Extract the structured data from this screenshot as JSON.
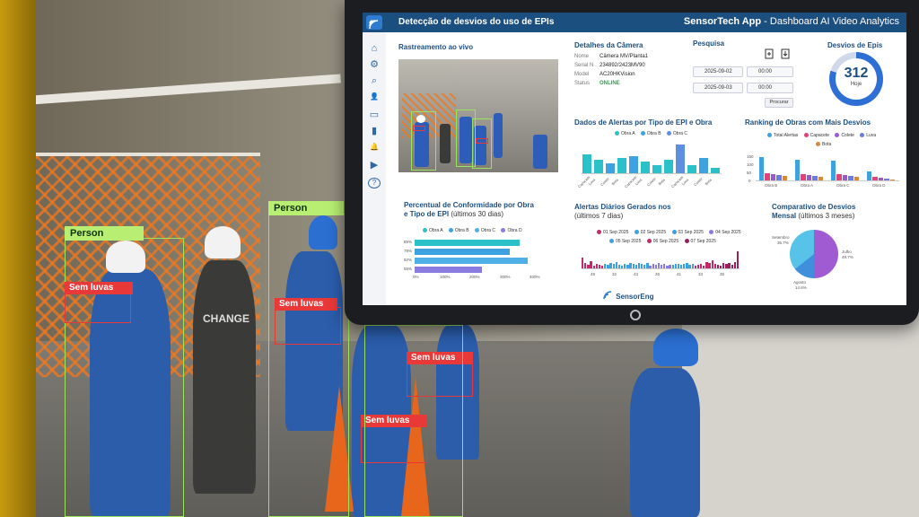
{
  "scene": {
    "labels": {
      "person_1": "Person",
      "person_2": "Person",
      "no_gloves_1": "Sem luvas",
      "no_gloves_2": "Sem luvas",
      "no_gloves_3": "Sem luvas",
      "no_gloves_4": "Sem luvas",
      "shirt_text": "CHANGE"
    }
  },
  "app": {
    "header_title": "Detecção de desvios do uso de EPIs",
    "app_name": "SensorTech App",
    "app_subtitle": " - Dashboard AI  Video Analytics",
    "footer_brand": "SensorEng"
  },
  "sidebar": {
    "items": [
      {
        "icon": "home-icon",
        "glyph": "⌂"
      },
      {
        "icon": "gear-icon",
        "glyph": "⚙"
      },
      {
        "icon": "search-icon",
        "glyph": "⌕"
      },
      {
        "icon": "user-icon",
        "glyph": "👤"
      },
      {
        "icon": "camera-icon",
        "glyph": "▭"
      },
      {
        "icon": "chart-icon",
        "glyph": "▮"
      },
      {
        "icon": "bell-icon",
        "glyph": "🔔"
      },
      {
        "icon": "video-icon",
        "glyph": "▶"
      },
      {
        "icon": "help-icon",
        "glyph": "?"
      }
    ]
  },
  "live": {
    "title": "Rastreamento ao vivo"
  },
  "camera": {
    "title": "Detalhes da Câmera",
    "rows": [
      {
        "label": "Nome",
        "value": "Câmera MV/Planta1"
      },
      {
        "label": "Serial N",
        "value": "234892/2423MV90"
      },
      {
        "label": "Model",
        "value": "AC20HKVision"
      },
      {
        "label": "Status",
        "value": "ONLINE"
      }
    ],
    "status_color": "#2aa84a"
  },
  "search": {
    "title": "Pesquisa",
    "date_from": "2025-09-02",
    "date_to": "2025-09-03",
    "time_from": "00:00",
    "time_to": "00:00",
    "search_button": "Procurar"
  },
  "desvios": {
    "title": "Desvios de Epis",
    "value": "312",
    "caption": "Hoje"
  },
  "alerts_by_type": {
    "title": "Dados de Alertas por Tipo de EPI e Obra",
    "legend": [
      "Obra A",
      "Obra B",
      "Obra C"
    ],
    "categories": [
      "Capacete",
      "Luva",
      "Colete",
      "Bota",
      "Capacete",
      "Luva",
      "Colete",
      "Bota",
      "Capacete",
      "Luva",
      "Colete",
      "Bota"
    ]
  },
  "ranking": {
    "title": "Ranking de Obras com Mais Desvios",
    "legend": [
      "Total Alertas",
      "Capacete",
      "Colete",
      "Luva",
      "Bota"
    ],
    "categories": [
      "Obra B",
      "Obra A",
      "Obra C",
      "Obra D"
    ],
    "yticks": [
      "150",
      "100",
      "50",
      "0"
    ]
  },
  "compliance": {
    "title": "Percentual de Conformidade por Obra e Tipo de EPI",
    "subtitle": " (últimos 30 dias)",
    "legend": [
      "Obra A",
      "Obra B",
      "Obra C",
      "Obra D"
    ],
    "rows": [
      "85%",
      "78%",
      "92%",
      "55%"
    ],
    "xticks": [
      "0%",
      "100%",
      "200%",
      "300%",
      "400%"
    ]
  },
  "daily": {
    "title": "Alertas Diários Gerados nos",
    "subtitle": "(últimos 7 dias)",
    "legend": [
      "01 Sep 2025",
      "02 Sep 2025",
      "03 Sep 2025",
      "04 Sep 2025",
      "05 Sep 2025",
      "06 Sep 2025",
      "07 Sep 2025"
    ],
    "xticks": [
      "48",
      "32",
      "43",
      "26",
      "41",
      "33",
      "35"
    ]
  },
  "monthly": {
    "title": "Comparativo de Desvios",
    "subtitle_bold": "Mensal",
    "subtitle": " (últimos 3 meses)",
    "slices": [
      {
        "label": "Julho",
        "pct": "49.7%"
      },
      {
        "label": "Agosto",
        "pct": "14.6%"
      },
      {
        "label": "Setembro",
        "pct": "35.7%"
      }
    ]
  },
  "chart_data": [
    {
      "type": "bar",
      "title": "Dados de Alertas por Tipo de EPI e Obra",
      "categories": [
        "Capacete",
        "Luva",
        "Colete",
        "Bota",
        "Capacete",
        "Luva",
        "Colete",
        "Bota",
        "Capacete",
        "Luva",
        "Colete",
        "Bota"
      ],
      "values": [
        22,
        16,
        12,
        18,
        20,
        14,
        10,
        16,
        34,
        9,
        18,
        6
      ],
      "colors": [
        "#2bc1c8",
        "#2bc1c8",
        "#3fa2e0",
        "#2bc1c8",
        "#3fa2e0",
        "#2bc1c8",
        "#2bc1c8",
        "#2bc1c8",
        "#5d8fe0",
        "#2bc1c8",
        "#3fa2e0",
        "#2bc1c8"
      ],
      "ylim": [
        0,
        40
      ]
    },
    {
      "type": "bar",
      "title": "Ranking de Obras com Mais Desvios",
      "categories": [
        "Obra B",
        "Obra A",
        "Obra C",
        "Obra D"
      ],
      "series": [
        {
          "name": "Total Alertas",
          "values": [
            140,
            125,
            120,
            55
          ],
          "color": "#3fa2e0"
        },
        {
          "name": "Capacete",
          "values": [
            45,
            40,
            35,
            20
          ],
          "color": "#e0427a"
        },
        {
          "name": "Colete",
          "values": [
            35,
            30,
            30,
            15
          ],
          "color": "#9b59d0"
        },
        {
          "name": "Luva",
          "values": [
            30,
            28,
            25,
            10
          ],
          "color": "#6d7be0"
        },
        {
          "name": "Bota",
          "values": [
            25,
            22,
            20,
            8
          ],
          "color": "#d58a3a"
        }
      ],
      "ylim": [
        0,
        150
      ]
    },
    {
      "type": "bar",
      "title": "Percentual de Conformidade por Obra e Tipo de EPI",
      "orientation": "horizontal",
      "categories": [
        "85%",
        "78%",
        "92%",
        "55%"
      ],
      "values": [
        345,
        312,
        372,
        222
      ],
      "colors": [
        "#2bc1c8",
        "#3fa2e0",
        "#4fb0e6",
        "#8a7be0"
      ],
      "xlim": [
        0,
        400
      ]
    },
    {
      "type": "bar",
      "title": "Alertas Diários Gerados nos",
      "categories": [
        "48",
        "32",
        "43",
        "26",
        "41",
        "33",
        "35"
      ],
      "series": [
        {
          "name": "01 Sep 2025",
          "values": [
            12,
            6,
            4,
            8,
            3,
            5,
            4,
            3
          ],
          "color": "#c22a6a"
        },
        {
          "name": "02 Sep 2025",
          "values": [
            5,
            4,
            6,
            5,
            7,
            4,
            3,
            5
          ],
          "color": "#3fa2e0"
        },
        {
          "name": "03 Sep 2025",
          "values": [
            4,
            6,
            5,
            4,
            6,
            5,
            4,
            6
          ],
          "color": "#3fa2e0"
        },
        {
          "name": "04 Sep 2025",
          "values": [
            3,
            5,
            4,
            6,
            4,
            5,
            3,
            4
          ],
          "color": "#8a7be0"
        },
        {
          "name": "05 Sep 2025",
          "values": [
            4,
            5,
            5,
            4,
            5,
            6,
            4,
            5
          ],
          "color": "#3fa2e0"
        },
        {
          "name": "06 Sep 2025",
          "values": [
            3,
            4,
            5,
            3,
            7,
            6,
            9,
            5
          ],
          "color": "#c22a6a"
        },
        {
          "name": "07 Sep 2025",
          "values": [
            4,
            3,
            6,
            5,
            6,
            4,
            7,
            20
          ],
          "color": "#9a1f5c"
        }
      ],
      "ylim": [
        0,
        25
      ]
    },
    {
      "type": "pie",
      "title": "Comparativo de Desvios Mensal",
      "categories": [
        "Julho",
        "Agosto",
        "Setembro"
      ],
      "values": [
        49.7,
        14.6,
        35.7
      ],
      "colors": [
        "#a05ad2",
        "#3f8fdc",
        "#57c3e8"
      ]
    }
  ]
}
